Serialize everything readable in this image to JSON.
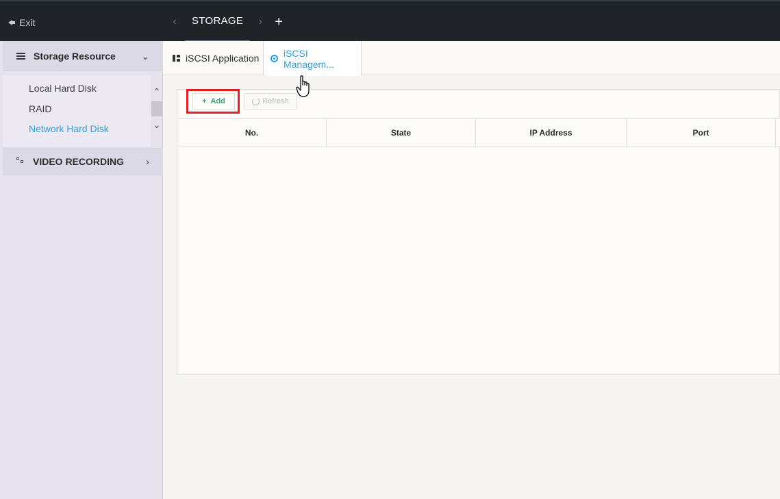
{
  "topbar": {
    "exit_label": "Exit",
    "prev_arrow": "‹",
    "next_arrow": "›",
    "active_tab": "STORAGE",
    "add_tab": "+"
  },
  "sidebar": {
    "header": {
      "title": "Storage Resource",
      "chevron": "⌄"
    },
    "items": [
      {
        "label": "Local Hard Disk",
        "active": false
      },
      {
        "label": "RAID",
        "active": false
      },
      {
        "label": "Network Hard Disk",
        "active": true
      }
    ],
    "scroll_up": "⌃",
    "scroll_down": "⌄",
    "section": {
      "title": "VIDEO RECORDING",
      "chevron": "›"
    }
  },
  "content_tabs": [
    {
      "label": "iSCSI Application",
      "icon": "grid-icon",
      "active": false
    },
    {
      "label": "iSCSI Managem...",
      "icon": "gear-icon",
      "active": true
    }
  ],
  "toolbar": {
    "add_label": "Add",
    "add_icon": "+",
    "refresh_label": "Refresh"
  },
  "table": {
    "columns": [
      "No.",
      "State",
      "IP Address",
      "Port"
    ],
    "rows": []
  },
  "colors": {
    "topbar_bg": "#1f2429",
    "accent": "#2aa0e2",
    "add_green": "#3d9e6e",
    "highlight_red": "#e01e26",
    "sidebar_bg": "#e6e3ee"
  }
}
